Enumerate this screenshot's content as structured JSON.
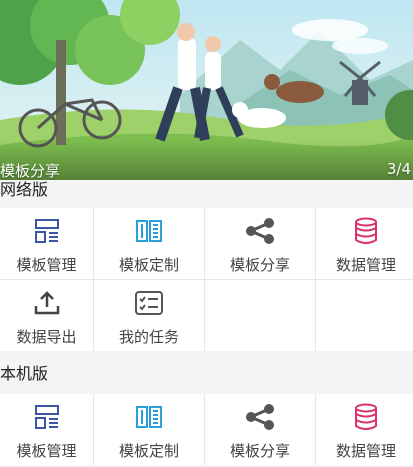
{
  "banner": {
    "caption": "模板分享",
    "counter": "3/4"
  },
  "sections": [
    {
      "title": "网络版",
      "items": [
        {
          "label": "模板管理",
          "icon": "template-manage-icon",
          "color": "#3a56a5"
        },
        {
          "label": "模板定制",
          "icon": "template-custom-icon",
          "color": "#2aa0d8"
        },
        {
          "label": "模板分享",
          "icon": "share-icon",
          "color": "#555555"
        },
        {
          "label": "数据管理",
          "icon": "database-icon",
          "color": "#d8336a"
        },
        {
          "label": "数据导出",
          "icon": "export-icon",
          "color": "#444444"
        },
        {
          "label": "我的任务",
          "icon": "task-list-icon",
          "color": "#555555"
        }
      ]
    },
    {
      "title": "本机版",
      "items": [
        {
          "label": "模板管理",
          "icon": "template-manage-icon",
          "color": "#3a56a5"
        },
        {
          "label": "模板定制",
          "icon": "template-custom-icon",
          "color": "#2aa0d8"
        },
        {
          "label": "模板分享",
          "icon": "share-icon",
          "color": "#555555"
        },
        {
          "label": "数据管理",
          "icon": "database-icon",
          "color": "#d8336a"
        }
      ]
    }
  ]
}
